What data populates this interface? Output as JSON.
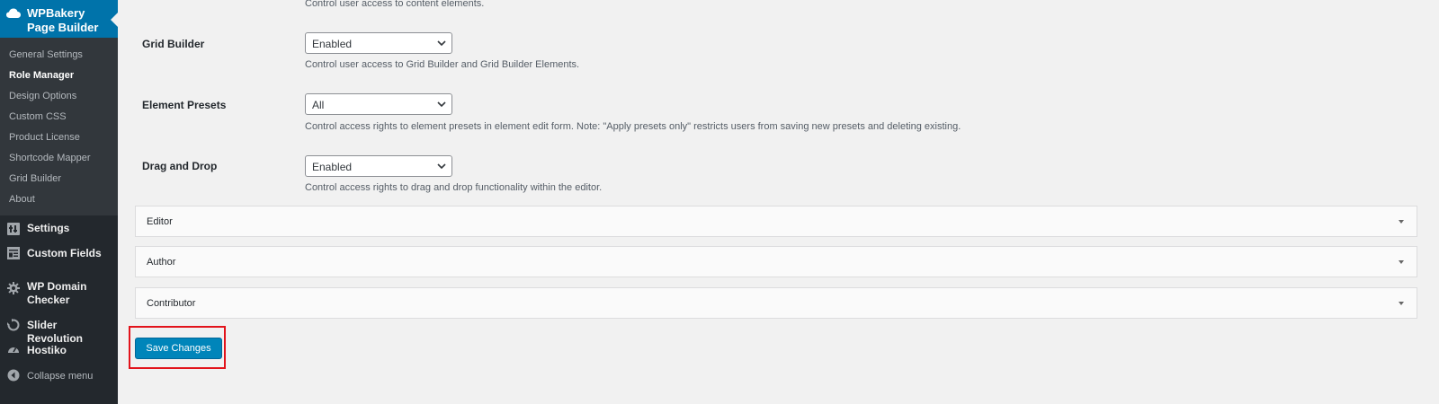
{
  "sidebar": {
    "plugin_title": "WPBakery Page Builder",
    "submenu": [
      {
        "label": "General Settings",
        "current": false
      },
      {
        "label": "Role Manager",
        "current": true
      },
      {
        "label": "Design Options",
        "current": false
      },
      {
        "label": "Custom CSS",
        "current": false
      },
      {
        "label": "Product License",
        "current": false
      },
      {
        "label": "Shortcode Mapper",
        "current": false
      },
      {
        "label": "Grid Builder",
        "current": false
      },
      {
        "label": "About",
        "current": false
      }
    ],
    "menu": [
      {
        "label": "Settings",
        "icon": "settings-icon"
      },
      {
        "label": "Custom Fields",
        "icon": "custom-fields-icon"
      },
      {
        "label": "WP Domain Checker",
        "icon": "gear-icon"
      },
      {
        "label": "Slider Revolution",
        "icon": "refresh-icon"
      },
      {
        "label": "Hostiko",
        "icon": "dashboard-icon"
      }
    ],
    "collapse_label": "Collapse menu",
    "accent_color": "#0073aa"
  },
  "main": {
    "top_description": "Control user access to content elements.",
    "fields": [
      {
        "label": "Grid Builder",
        "value": "Enabled",
        "description": "Control user access to Grid Builder and Grid Builder Elements."
      },
      {
        "label": "Element Presets",
        "value": "All",
        "description": "Control access rights to element presets in element edit form. Note: \"Apply presets only\" restricts users from saving new presets and deleting existing."
      },
      {
        "label": "Drag and Drop",
        "value": "Enabled",
        "description": "Control access rights to drag and drop functionality within the editor."
      }
    ],
    "roles": [
      {
        "label": "Editor"
      },
      {
        "label": "Author"
      },
      {
        "label": "Contributor"
      }
    ],
    "save_label": "Save Changes",
    "button_color": "#0085ba",
    "highlight_color": "#e2131b"
  }
}
